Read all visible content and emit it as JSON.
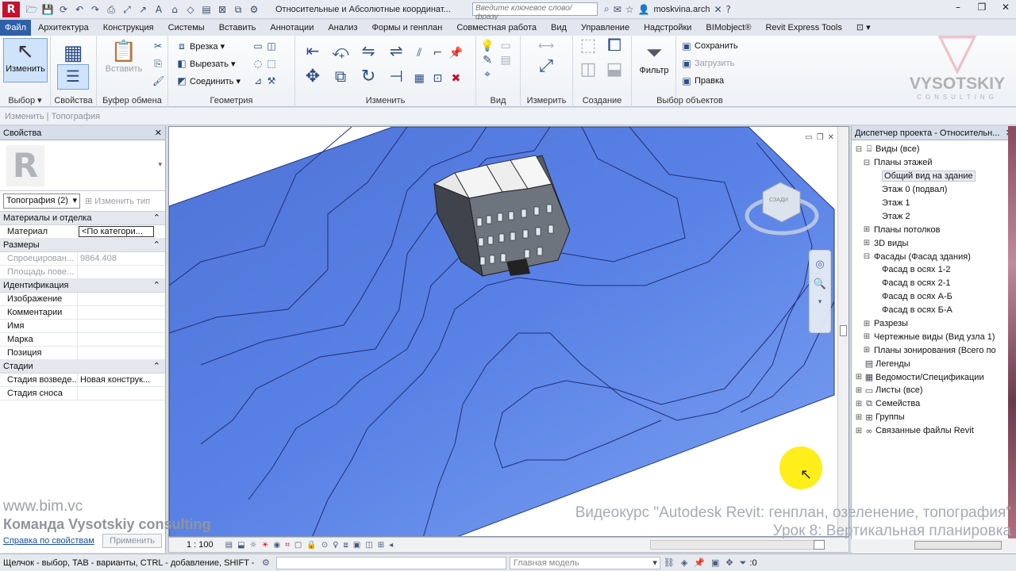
{
  "app": {
    "doc_title": "Относительные и Абсолютные координат...",
    "search_placeholder": "Введите ключевое слово/фразу",
    "username": "moskvina.arch"
  },
  "tabs": [
    "Файл",
    "Архитектура",
    "Конструкция",
    "Системы",
    "Вставить",
    "Аннотации",
    "Анализ",
    "Формы и генплан",
    "Совместная работа",
    "Вид",
    "Управление",
    "Надстройки",
    "BIMobject®",
    "Revit Express Tools"
  ],
  "ribbon": {
    "modify_label": "Изменить",
    "select_label": "Выбор ▾",
    "properties_label": "Свойства",
    "clipboard": {
      "paste": "Вставить",
      "label": "Буфер обмена"
    },
    "geometry": {
      "cut": "Врезка ▾",
      "cut2": "Вырезать ▾",
      "join": "Соединить ▾",
      "label": "Геометрия"
    },
    "modify_panel_label": "Изменить",
    "view_label": "Вид",
    "measure_label": "Измерить",
    "create_label": "Создание",
    "filter_label": "Фильтр",
    "selection": {
      "save": "Сохранить",
      "load": "Загрузить",
      "edit": "Правка",
      "label": "Выбор объектов"
    }
  },
  "context_bar": "Изменить | Топография",
  "properties": {
    "title": "Свойства",
    "type_selector": "Топография (2)",
    "edit_type": "Изменить тип",
    "groups": [
      {
        "name": "Материалы и отделка",
        "rows": [
          {
            "k": "Материал",
            "v": "<По категори...",
            "boxed": true
          }
        ]
      },
      {
        "name": "Размеры",
        "rows": [
          {
            "k": "Спроецирован...",
            "v": "9864.408",
            "dis": true
          },
          {
            "k": "Площадь пове...",
            "v": "",
            "dis": true
          }
        ]
      },
      {
        "name": "Идентификация",
        "rows": [
          {
            "k": "Изображение",
            "v": ""
          },
          {
            "k": "Комментарии",
            "v": ""
          },
          {
            "k": "Имя",
            "v": ""
          },
          {
            "k": "Марка",
            "v": ""
          },
          {
            "k": "Позиция",
            "v": ""
          }
        ]
      },
      {
        "name": "Стадии",
        "rows": [
          {
            "k": "Стадия возведе...",
            "v": "Новая конструк..."
          },
          {
            "k": "Стадия сноса",
            "v": ""
          }
        ]
      }
    ],
    "help_link": "Справка по свойствам",
    "apply": "Применить"
  },
  "view": {
    "scale": "1 : 100",
    "viewcube": "СЗАДИ"
  },
  "browser": {
    "title": "Диспетчер проекта - Относительн...",
    "items": [
      {
        "label": "Виды (все)",
        "depth": 0,
        "exp": "⊟",
        "icon": "views-icon"
      },
      {
        "label": "Планы этажей",
        "depth": 1,
        "exp": "⊟"
      },
      {
        "label": "Общий вид на здание",
        "depth": 3,
        "sel": true
      },
      {
        "label": "Этаж 0 (подвал)",
        "depth": 3
      },
      {
        "label": "Этаж 1",
        "depth": 3
      },
      {
        "label": "Этаж 2",
        "depth": 3
      },
      {
        "label": "Планы потолков",
        "depth": 1,
        "exp": "⊞"
      },
      {
        "label": "3D виды",
        "depth": 1,
        "exp": "⊞"
      },
      {
        "label": "Фасады (Фасад здания)",
        "depth": 1,
        "exp": "⊟"
      },
      {
        "label": "Фасад в осях 1-2",
        "depth": 3
      },
      {
        "label": "Фасад в осях 2-1",
        "depth": 3
      },
      {
        "label": "Фасад в осях А-Б",
        "depth": 3
      },
      {
        "label": "Фасад в осях Б-А",
        "depth": 3
      },
      {
        "label": "Разрезы",
        "depth": 1,
        "exp": "⊞"
      },
      {
        "label": "Чертежные виды (Вид узла 1)",
        "depth": 1,
        "exp": "⊞"
      },
      {
        "label": "Планы зонирования (Всего по",
        "depth": 1,
        "exp": "⊞"
      },
      {
        "label": "Легенды",
        "depth": 0,
        "exp": "",
        "icon": "legend-icon"
      },
      {
        "label": "Ведомости/Спецификации",
        "depth": 0,
        "exp": "⊞",
        "icon": "schedule-icon"
      },
      {
        "label": "Листы (все)",
        "depth": 0,
        "exp": "⊞",
        "icon": "sheets-icon"
      },
      {
        "label": "Семейства",
        "depth": 0,
        "exp": "⊞",
        "icon": "families-icon"
      },
      {
        "label": "Группы",
        "depth": 0,
        "exp": "⊞",
        "icon": "groups-icon"
      },
      {
        "label": "Связанные файлы Revit",
        "depth": 0,
        "exp": "⊞",
        "icon": "links-icon"
      }
    ]
  },
  "status": {
    "message": "Щелчок - выбор, TAB - варианты, CTRL - добавление, SHIFT -",
    "model": "Главная модель",
    "count": ":0"
  },
  "overlays": {
    "brand": "VYSOTSKIY",
    "brand_sub": "CONSULTING",
    "site": "www.bim.vc",
    "team": "Команда Vysotskiy consulting",
    "course": "Видеокурс \"Autodesk Revit: генплан, озеленение, топография\"",
    "lesson": "Урок 8: Вертикальная планировка"
  }
}
